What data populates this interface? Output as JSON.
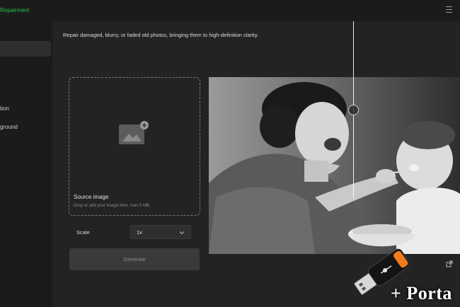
{
  "header": {
    "brand": "Repairment"
  },
  "sidebar": {
    "items": [
      {
        "label": "",
        "active": true
      },
      {
        "label": "tion",
        "active": false
      },
      {
        "label": "ground",
        "active": false
      }
    ]
  },
  "main": {
    "description": "Repair damaged, blurry, or faded old photos, bringing them to high-definition clarity.",
    "source": {
      "title": "Source image",
      "hint": "Drop or add your image here, max 5 MB."
    },
    "scale": {
      "label": "Scale",
      "value": "1x"
    },
    "generate_label": "Generate"
  },
  "watermark": {
    "text": "+ Porta"
  },
  "icons": {
    "menu": "hamburger-icon",
    "add_image": "add-image-icon",
    "chevron": "chevron-down-icon",
    "compare": "compare-handle-icon",
    "open": "open-external-icon",
    "usb": "usb-drive-icon"
  },
  "colors": {
    "brand": "#25c24a",
    "background": "#1c1c1c",
    "panel": "#232323",
    "button": "#3a3a3a",
    "usb_accent": "#f07b1c"
  }
}
